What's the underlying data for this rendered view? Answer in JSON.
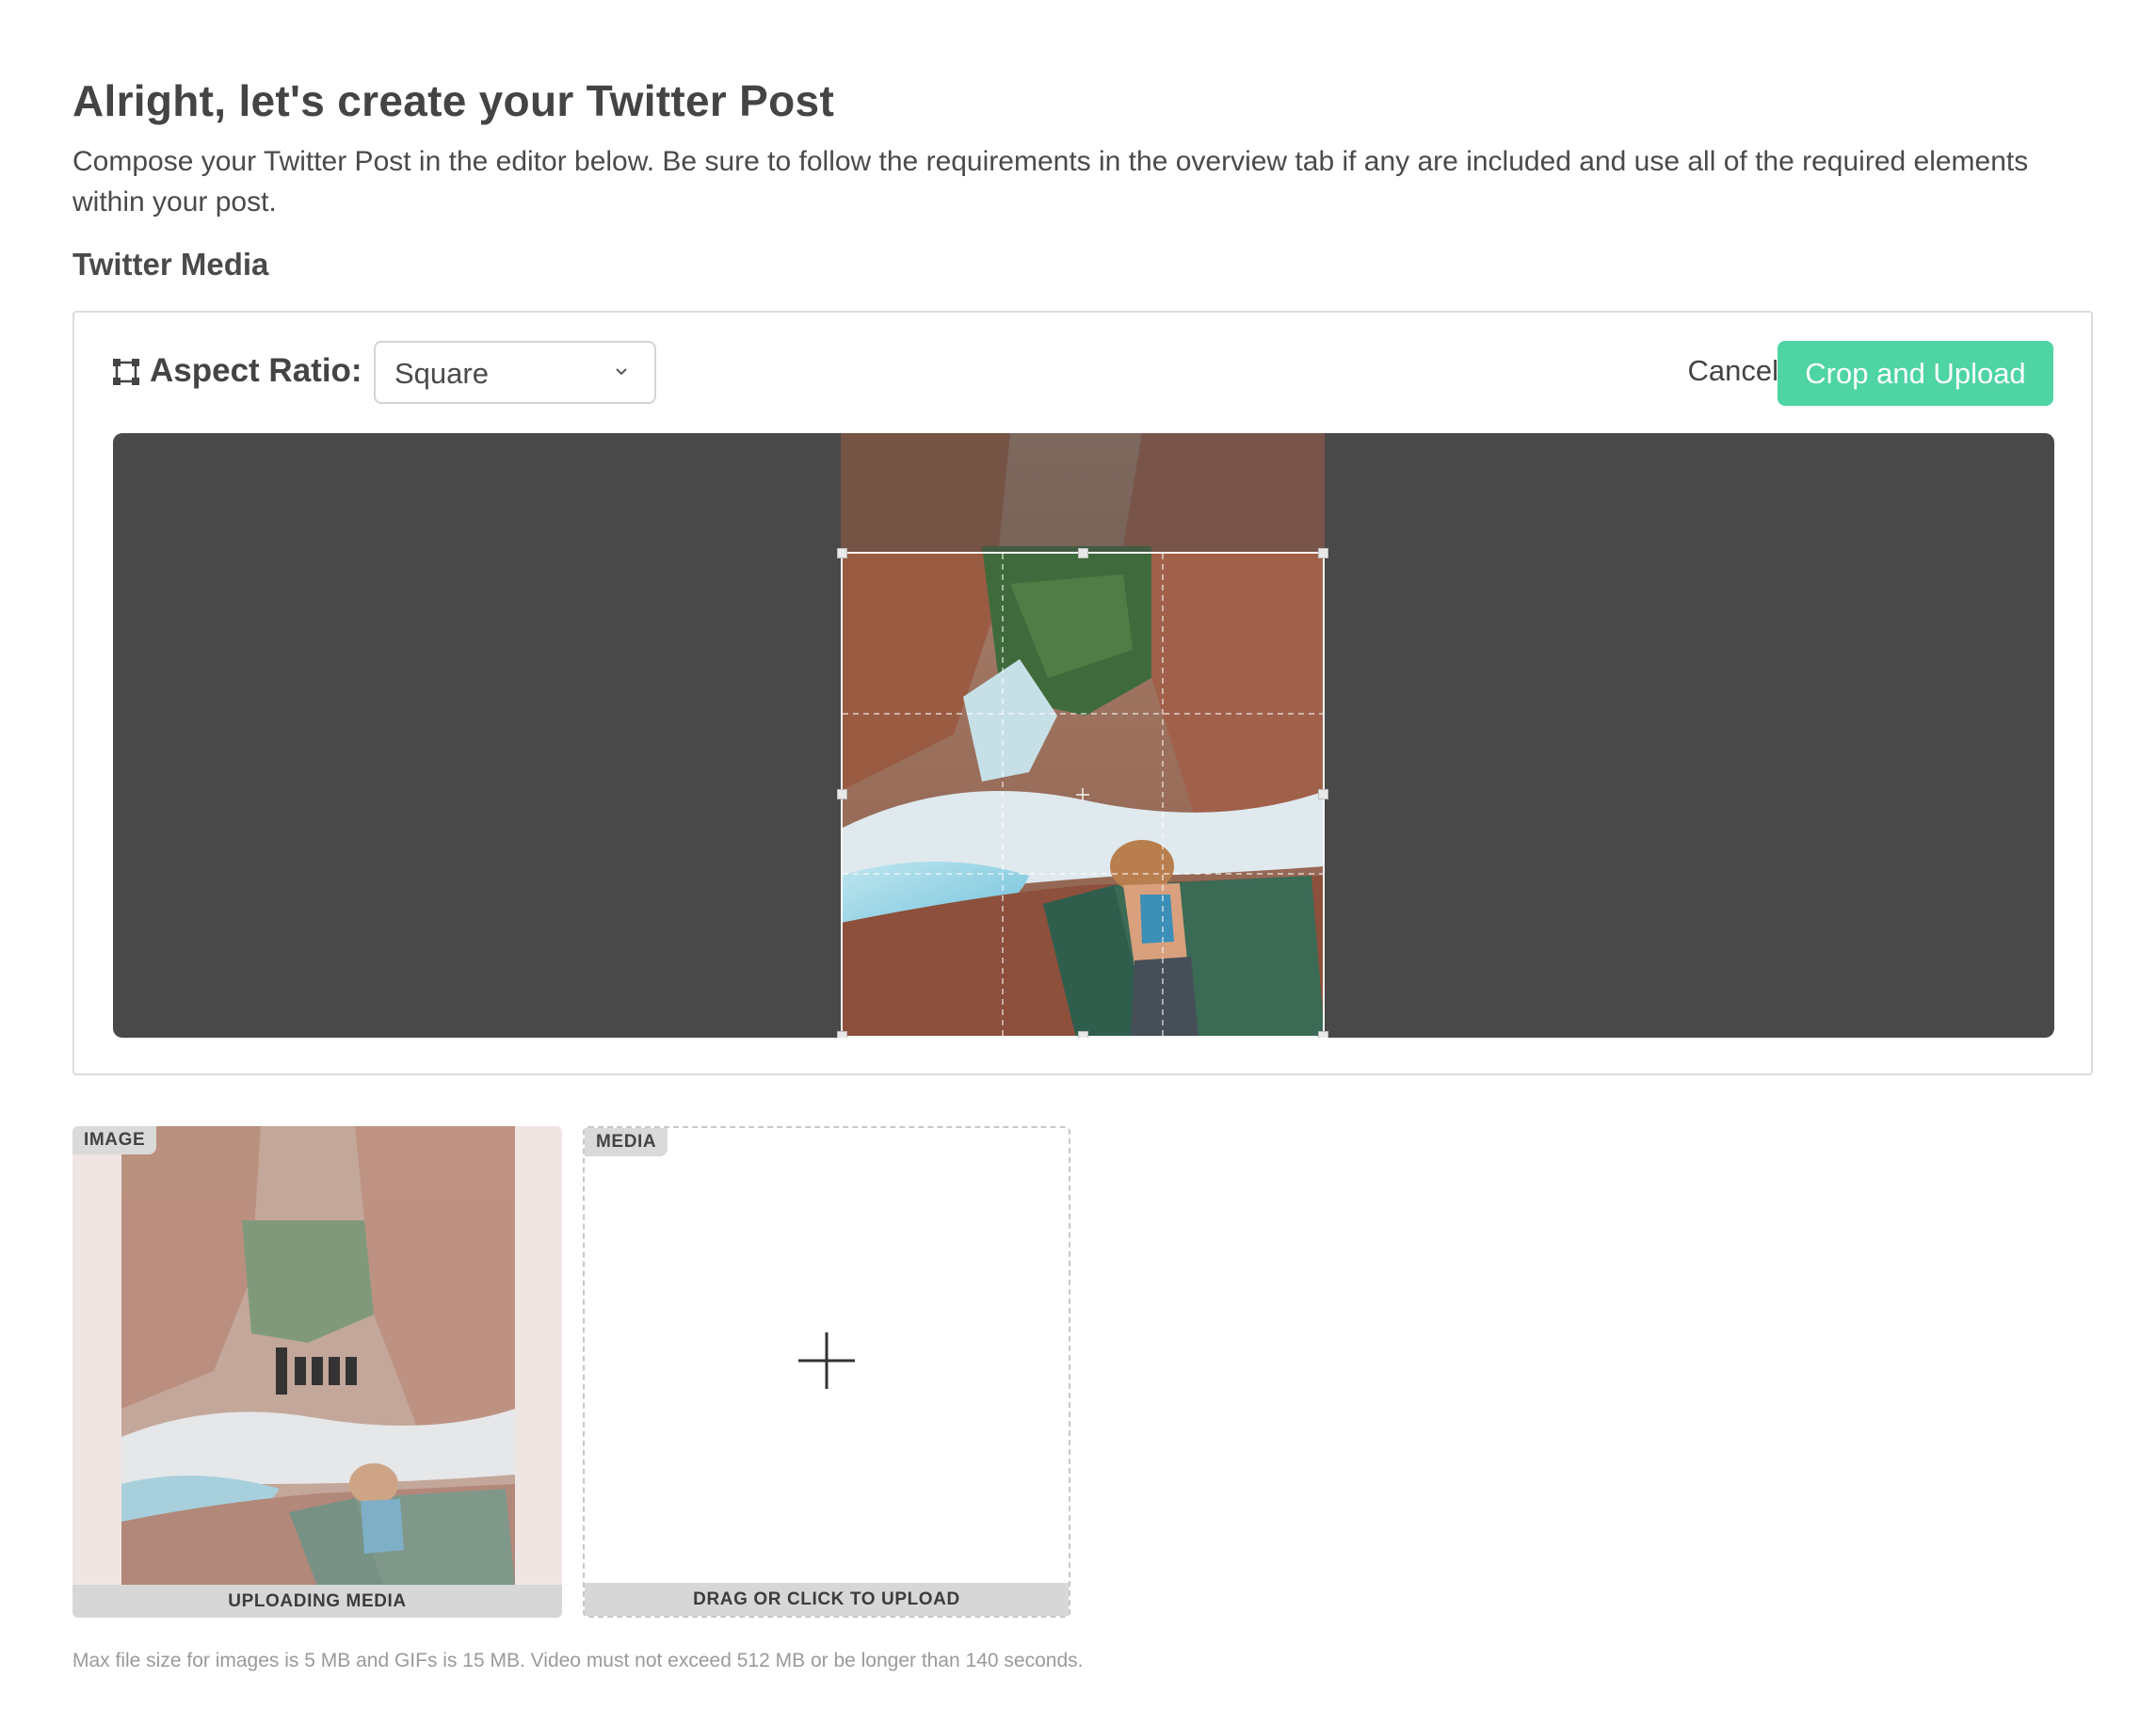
{
  "header": {
    "title": "Alright, let's create your Twitter Post",
    "description": "Compose your Twitter Post in the editor below. Be sure to follow the requirements in the overview tab if any are included and use all of the required elements within your post."
  },
  "media_section": {
    "title": "Twitter Media"
  },
  "editor": {
    "aspect_ratio_label": "Aspect Ratio:",
    "aspect_ratio_value": "Square",
    "cancel_label": "Cancel",
    "crop_upload_label": "Crop and Upload",
    "accent_color": "#4fd4a4",
    "canvas_color": "#494949"
  },
  "thumbnails": [
    {
      "tag": "IMAGE",
      "footer": "UPLOADING MEDIA"
    },
    {
      "tag": "MEDIA",
      "footer": "DRAG OR CLICK TO UPLOAD"
    }
  ],
  "footnote": "Max file size for images is 5 MB and GIFs is 15 MB. Video must not exceed 512 MB or be longer than 140 seconds."
}
